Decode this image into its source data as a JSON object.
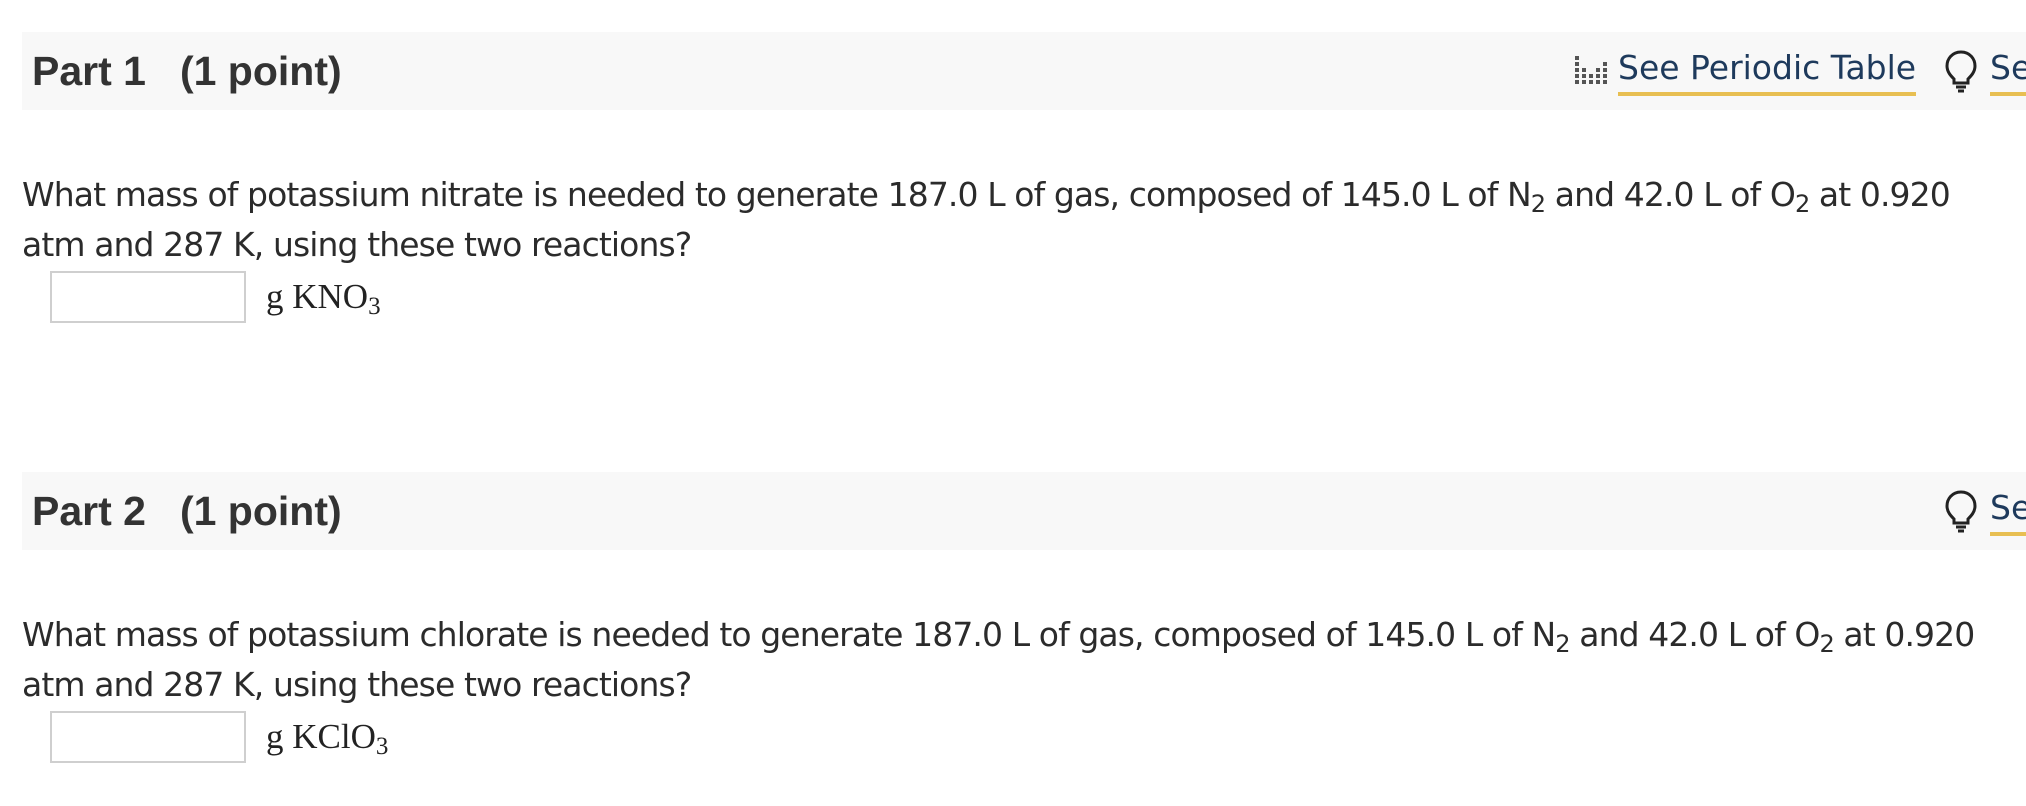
{
  "part1": {
    "title": "Part 1",
    "points": "(1 point)",
    "periodic_table_label": "See Periodic Table",
    "hint_label": "Se",
    "question": {
      "segments": [
        "What mass of potassium nitrate is needed to generate 187.0  L of gas, composed of 145.0  L of N",
        "2",
        " and 42.0  L of O",
        "2",
        " at 0.920 atm and 287  K, using these two reactions?"
      ]
    },
    "answer": {
      "value": "",
      "unit_prefix": "g KNO",
      "unit_sub": "3"
    }
  },
  "part2": {
    "title": "Part 2",
    "points": "(1 point)",
    "hint_label": "Se",
    "question": {
      "segments": [
        "What mass of potassium chlorate is needed to generate 187.0 L of gas, composed of 145.0 L of N",
        "2",
        " and 42.0 L of O",
        "2",
        " at 0.920 atm and 287 K, using these two reactions?"
      ]
    },
    "answer": {
      "value": "",
      "unit_prefix": "g KClO",
      "unit_sub": "3"
    }
  },
  "colors": {
    "link_text": "#1e3a5c",
    "link_underline": "#e8bf52",
    "header_background": "#f8f8f8"
  },
  "icons": {
    "periodic_table": "periodic-table-icon",
    "hint": "lightbulb-icon"
  }
}
